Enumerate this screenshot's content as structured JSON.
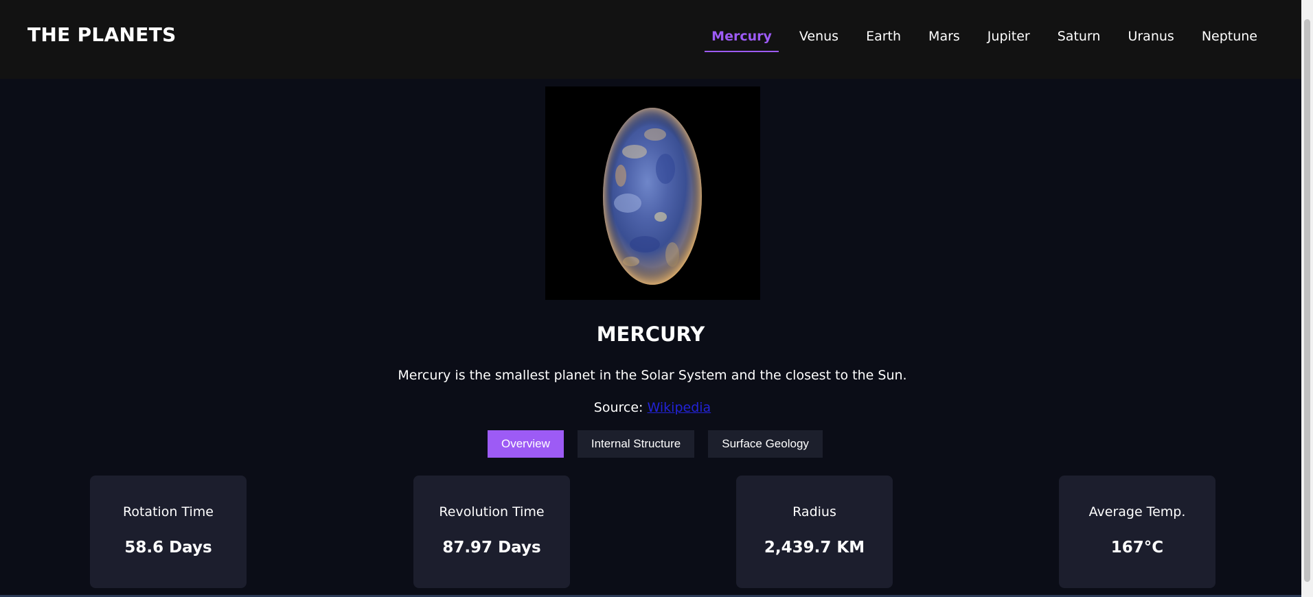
{
  "header": {
    "logo": "THE PLANETS",
    "nav": [
      {
        "label": "Mercury",
        "active": true
      },
      {
        "label": "Venus",
        "active": false
      },
      {
        "label": "Earth",
        "active": false
      },
      {
        "label": "Mars",
        "active": false
      },
      {
        "label": "Jupiter",
        "active": false
      },
      {
        "label": "Saturn",
        "active": false
      },
      {
        "label": "Uranus",
        "active": false
      },
      {
        "label": "Neptune",
        "active": false
      }
    ]
  },
  "planet": {
    "name": "MERCURY",
    "description": "Mercury is the smallest planet in the Solar System and the closest to the Sun.",
    "source_prefix": "Source:",
    "source_link": "Wikipedia"
  },
  "tabs": [
    {
      "label": "Overview",
      "active": true
    },
    {
      "label": "Internal Structure",
      "active": false
    },
    {
      "label": "Surface Geology",
      "active": false
    }
  ],
  "stats": [
    {
      "label": "Rotation Time",
      "value": "58.6 Days"
    },
    {
      "label": "Revolution Time",
      "value": "87.97 Days"
    },
    {
      "label": "Radius",
      "value": "2,439.7 KM"
    },
    {
      "label": "Average Temp.",
      "value": "167°C"
    }
  ],
  "colors": {
    "accent": "#9d5bf5",
    "background": "#0b0d17",
    "header": "#121212",
    "card": "#1c1e2d",
    "link": "#2323d8"
  }
}
